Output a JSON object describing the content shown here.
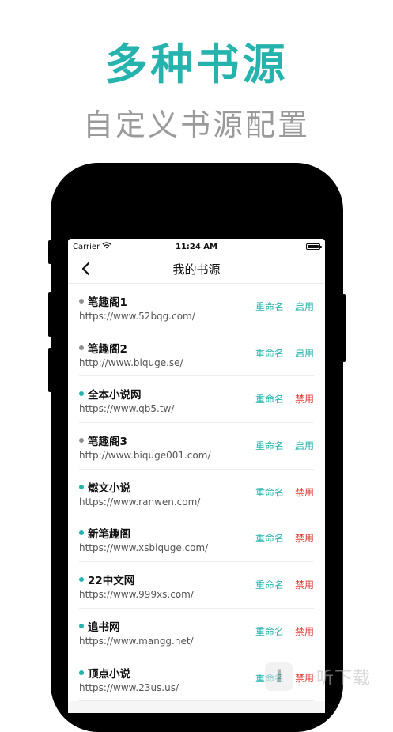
{
  "promo": {
    "headline": "多种书源",
    "subline": "自定义书源配置"
  },
  "status_bar": {
    "carrier": "Carrier",
    "time": "11:24 AM"
  },
  "nav": {
    "title": "我的书源"
  },
  "colors": {
    "accent": "#27b3ad",
    "disable": "#e53935",
    "inactive_dot": "#8f8f8f"
  },
  "sources": [
    {
      "name": "笔趣阁1",
      "url": "https://www.52bqg.com/",
      "rename": "重命名",
      "toggle": "启用",
      "active": false
    },
    {
      "name": "笔趣阁2",
      "url": "http://www.biquge.se/",
      "rename": "重命名",
      "toggle": "启用",
      "active": false
    },
    {
      "name": "全本小说网",
      "url": "https://www.qb5.tw/",
      "rename": "重命名",
      "toggle": "禁用",
      "active": true
    },
    {
      "name": "笔趣阁3",
      "url": "http://www.biquge001.com/",
      "rename": "重命名",
      "toggle": "启用",
      "active": false
    },
    {
      "name": "燃文小说",
      "url": "https://www.ranwen.com/",
      "rename": "重命名",
      "toggle": "禁用",
      "active": true
    },
    {
      "name": "新笔趣阁",
      "url": "https://www.xsbiquge.com/",
      "rename": "重命名",
      "toggle": "禁用",
      "active": true
    },
    {
      "name": "22中文网",
      "url": "https://www.999xs.com/",
      "rename": "重命名",
      "toggle": "禁用",
      "active": true
    },
    {
      "name": "追书网",
      "url": "https://www.mangg.net/",
      "rename": "重命名",
      "toggle": "禁用",
      "active": true
    },
    {
      "name": "顶点小说",
      "url": "https://www.23us.us/",
      "rename": "重命名",
      "toggle": "禁用",
      "active": true
    }
  ],
  "watermark": {
    "logo_char": "I",
    "text": "一听下载"
  }
}
